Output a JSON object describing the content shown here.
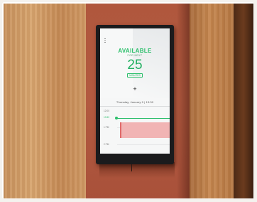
{
  "screen": {
    "status_title": "AVAILABLE",
    "status_subtitle": "FOR NEXT",
    "minutes_value": "25",
    "minutes_unit": "MINUTES",
    "add_icon": "plus-icon",
    "menu_icon": "menu-icon",
    "date_line": "Thursday, January 9 | 13:30"
  },
  "timeline": {
    "labels": [
      "12:00",
      "13:30",
      "1 PM",
      "2 PM"
    ],
    "current_time_label": "13:30"
  },
  "colors": {
    "available_green": "#2bbf6a",
    "event_pink": "#f1b4b4",
    "panel_terracotta": "#b0573d"
  }
}
